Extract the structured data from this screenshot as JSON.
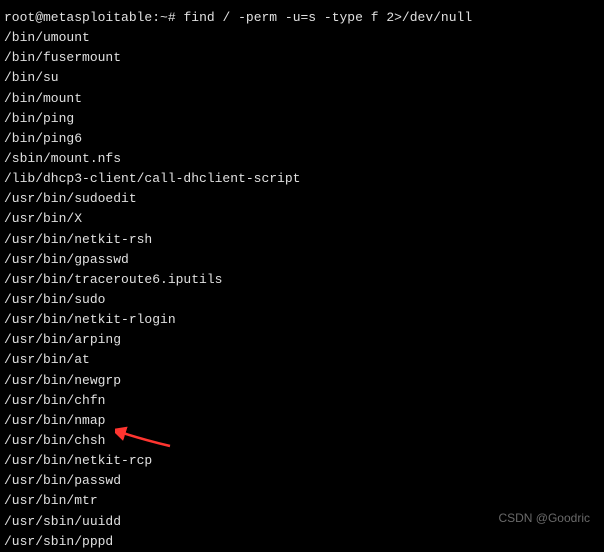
{
  "prompt": {
    "user_host": "root@metasploitable",
    "separator": ":",
    "path": "~",
    "symbol": "#",
    "command": "find / -perm -u=s -type f 2>/dev/null"
  },
  "output_lines": [
    "/bin/umount",
    "/bin/fusermount",
    "/bin/su",
    "/bin/mount",
    "/bin/ping",
    "/bin/ping6",
    "/sbin/mount.nfs",
    "/lib/dhcp3-client/call-dhclient-script",
    "/usr/bin/sudoedit",
    "/usr/bin/X",
    "/usr/bin/netkit-rsh",
    "/usr/bin/gpasswd",
    "/usr/bin/traceroute6.iputils",
    "/usr/bin/sudo",
    "/usr/bin/netkit-rlogin",
    "/usr/bin/arping",
    "/usr/bin/at",
    "/usr/bin/newgrp",
    "/usr/bin/chfn",
    "/usr/bin/nmap",
    "/usr/bin/chsh",
    "/usr/bin/netkit-rcp",
    "/usr/bin/passwd",
    "/usr/bin/mtr",
    "/usr/sbin/uuidd",
    "/usr/sbin/pppd"
  ],
  "highlight_index": 19,
  "watermark": "CSDN @Goodric"
}
